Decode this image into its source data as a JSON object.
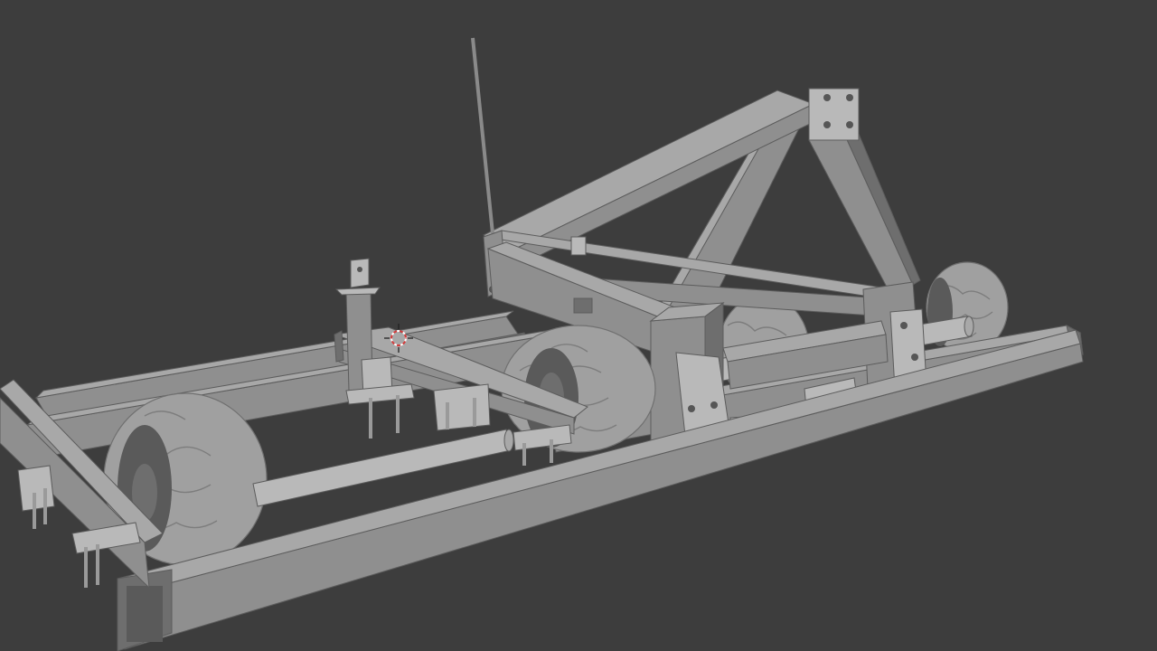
{
  "viewport": {
    "background": "#3d3d3d",
    "mesh_color": "#9a9a9a"
  },
  "icons": {
    "cursor": "3d-cursor-icon"
  }
}
